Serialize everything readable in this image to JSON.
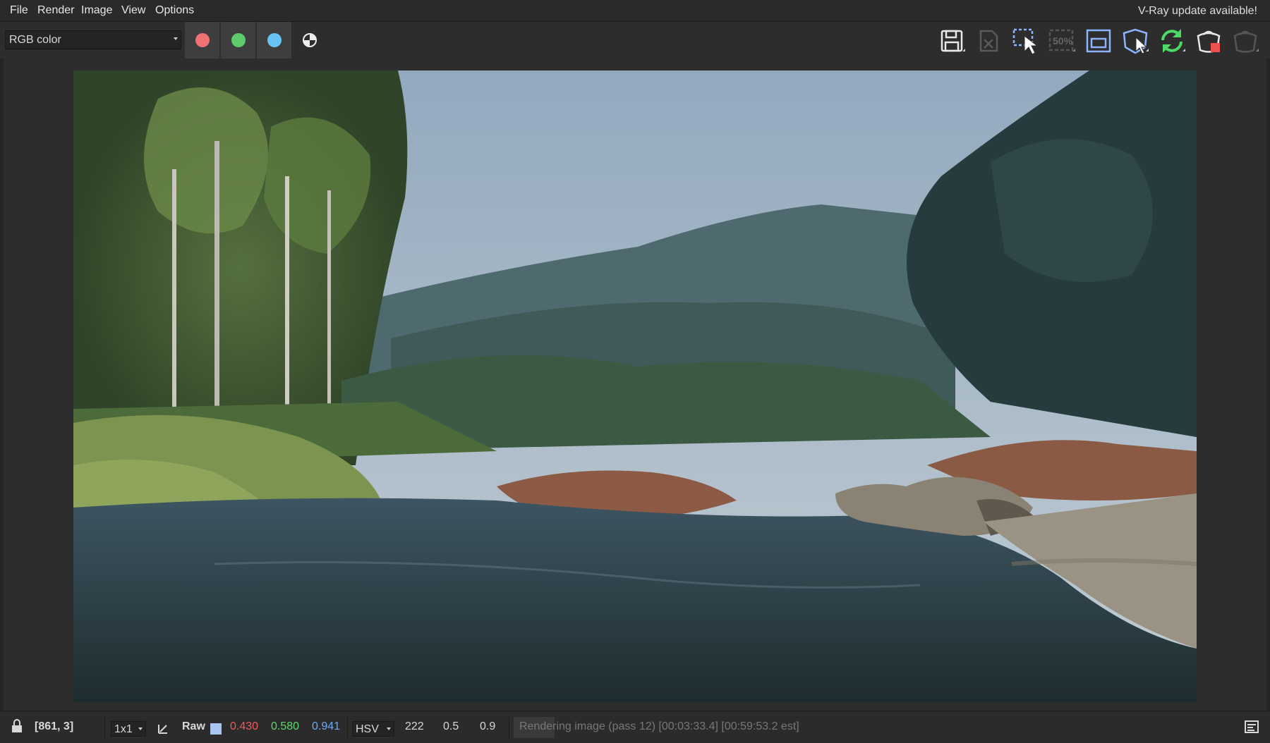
{
  "menu": {
    "file": "File",
    "render": "Render",
    "image": "Image",
    "view": "View",
    "options": "Options",
    "update_notice": "V-Ray update available!"
  },
  "toolbar": {
    "channel": "RGB color",
    "channel_buttons": [
      {
        "name": "red-channel",
        "color": "#f07171"
      },
      {
        "name": "green-channel",
        "color": "#5ecb6a"
      },
      {
        "name": "blue-channel",
        "color": "#67c3f2"
      }
    ],
    "tools": [
      "save-image-icon",
      "clear-image-icon",
      "region-render-icon",
      "zoom-50-icon",
      "frame-icon",
      "interactive-render-icon",
      "refresh-icon",
      "render-icon",
      "stop-render-icon"
    ],
    "zoom_label": "50%"
  },
  "status": {
    "coords": "[861, 3]",
    "sample_size": "1x1",
    "raw_label": "Raw",
    "r": "0.430",
    "g": "0.580",
    "b": "0.941",
    "color_mode": "HSV",
    "h": "222",
    "s": "0.5",
    "v": "0.9",
    "progress": "Rendering image (pass 12) [00:03:33.4] [00:59:53.2 est]",
    "swatch_color": "#a9c3f2"
  }
}
